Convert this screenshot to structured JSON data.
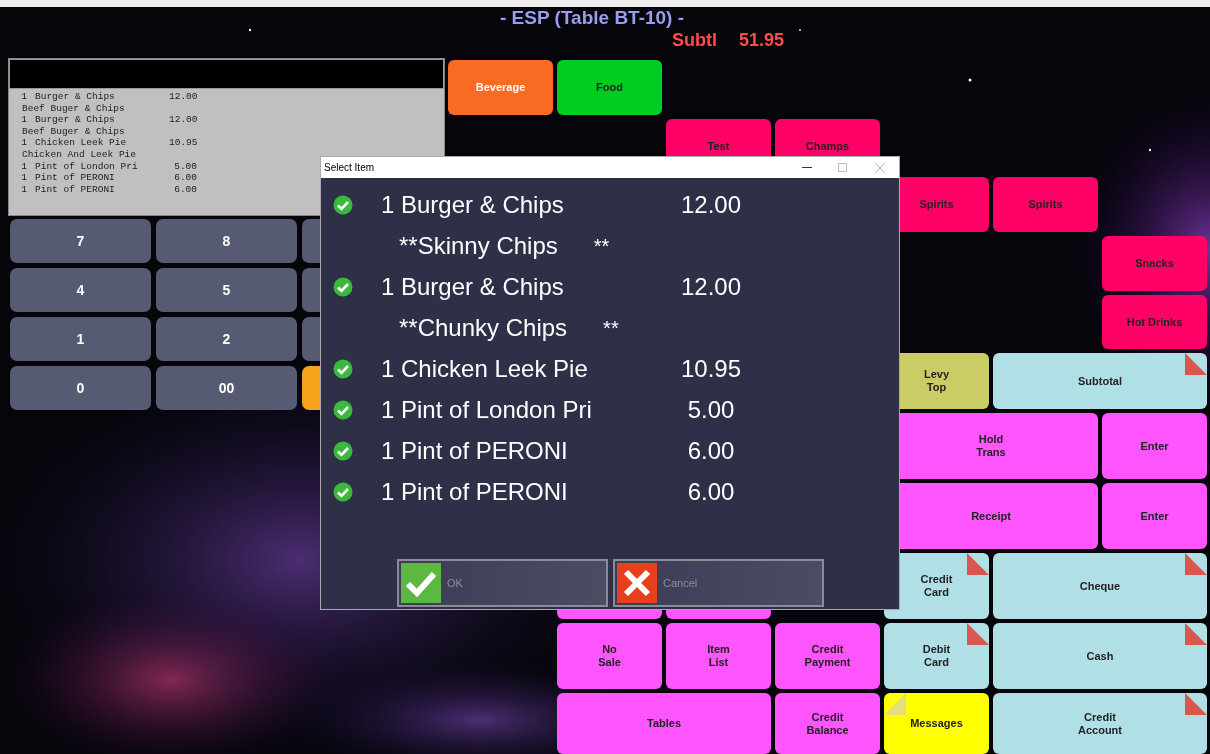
{
  "header": {
    "title": "- ESP (Table BT-10) -",
    "subtotal_label": "Subtl",
    "subtotal_value": "51.95"
  },
  "receipt": {
    "lines": [
      {
        "kind": "item",
        "qty": "1",
        "name": "Burger & Chips",
        "price": "12.00"
      },
      {
        "kind": "note",
        "text": "Beef Buger & Chips"
      },
      {
        "kind": "item",
        "qty": "1",
        "name": "Burger & Chips",
        "price": "12.00"
      },
      {
        "kind": "note",
        "text": "Beef Buger & Chips"
      },
      {
        "kind": "item",
        "qty": "1",
        "name": "Chicken Leek Pie",
        "price": "10.95"
      },
      {
        "kind": "note",
        "text": "Chicken And Leek Pie"
      },
      {
        "kind": "item",
        "qty": "1",
        "name": "Pint of London Pri",
        "price": "5.00"
      },
      {
        "kind": "item",
        "qty": "1",
        "name": "Pint of PERONI",
        "price": "6.00"
      },
      {
        "kind": "item",
        "qty": "1",
        "name": "Pint of PERONI",
        "price": "6.00"
      }
    ]
  },
  "keypad": [
    {
      "label": "7",
      "color": "#565a72"
    },
    {
      "label": "8",
      "color": "#565a72"
    },
    {
      "color": "#565a72"
    },
    {
      "label": "4",
      "color": "#565a72"
    },
    {
      "label": "5",
      "color": "#565a72"
    },
    {
      "color": "#565a72"
    },
    {
      "label": "1",
      "color": "#565a72"
    },
    {
      "label": "2",
      "color": "#565a72"
    },
    {
      "color": "#565a72"
    },
    {
      "label": "0",
      "color": "#565a72"
    },
    {
      "label": "00",
      "color": "#565a72"
    },
    {
      "color": "#f7a21b"
    }
  ],
  "buttons": [
    {
      "label": "Beverage",
      "color": "#f96a22",
      "light_text": true
    },
    {
      "label": "Food",
      "color": "#00cc22"
    },
    {
      "label": "Test",
      "color": "#ff0066"
    },
    {
      "label": "Champs",
      "color": "#ff0066"
    },
    {
      "label": "Spirits",
      "color": "#ff0066"
    },
    {
      "label": "Spirits",
      "color": "#ff0066"
    },
    {
      "label": "Snacks",
      "color": "#ff0066"
    },
    {
      "label": "Hot Drinks",
      "color": "#ff0066"
    },
    {
      "label": "Levy\nTop",
      "color": "#cccc66"
    },
    {
      "label": "Subtotal",
      "color": "#b0e0e6",
      "folded": true
    },
    {
      "label": "Hold\nTrans",
      "color": "#ff55ff"
    },
    {
      "label": "Enter",
      "color": "#ff55ff"
    },
    {
      "label": "Receipt",
      "color": "#ff55ff"
    },
    {
      "label": "Enter",
      "color": "#ff55ff"
    },
    {
      "color": "#ff55ff"
    },
    {
      "color": "#ff55ff"
    },
    {
      "label": "Credit\nCard",
      "color": "#b0e0e6",
      "folded": true
    },
    {
      "label": "Cheque",
      "color": "#b0e0e6",
      "folded": true
    },
    {
      "label": "No\nSale",
      "color": "#ff55ff"
    },
    {
      "label": "Item\nList",
      "color": "#ff55ff"
    },
    {
      "label": "Credit\nPayment",
      "color": "#ff55ff"
    },
    {
      "label": "Debit\nCard",
      "color": "#b0e0e6",
      "folded": true
    },
    {
      "label": "Cash",
      "color": "#b0e0e6",
      "folded": true
    },
    {
      "label": "Tables",
      "color": "#ff55ff"
    },
    {
      "label": "Credit\nBalance",
      "color": "#ff55ff"
    },
    {
      "label": "Messages",
      "color": "#ffff00",
      "folded": true,
      "fold_left": true
    },
    {
      "label": "Credit\nAccount",
      "color": "#b0e0e6",
      "folded": true
    }
  ],
  "dialog": {
    "title": "Select Item",
    "items": [
      {
        "kind": "item",
        "checked": true,
        "text": "1 Burger & Chips",
        "price": "12.00"
      },
      {
        "kind": "modifier",
        "text": "**Skinny Chips",
        "suffix": "**"
      },
      {
        "kind": "item",
        "checked": true,
        "text": "1 Burger & Chips",
        "price": "12.00"
      },
      {
        "kind": "modifier",
        "text": "**Chunky Chips",
        "suffix": "**"
      },
      {
        "kind": "item",
        "checked": true,
        "text": "1 Chicken Leek Pie",
        "price": "10.95"
      },
      {
        "kind": "item",
        "checked": true,
        "text": "1 Pint of London Pri",
        "price": "5.00"
      },
      {
        "kind": "item",
        "checked": true,
        "text": "1 Pint of PERONI",
        "price": "6.00"
      },
      {
        "kind": "item",
        "checked": true,
        "text": "1 Pint of PERONI",
        "price": "6.00"
      }
    ],
    "ok": "OK",
    "cancel": "Cancel"
  }
}
